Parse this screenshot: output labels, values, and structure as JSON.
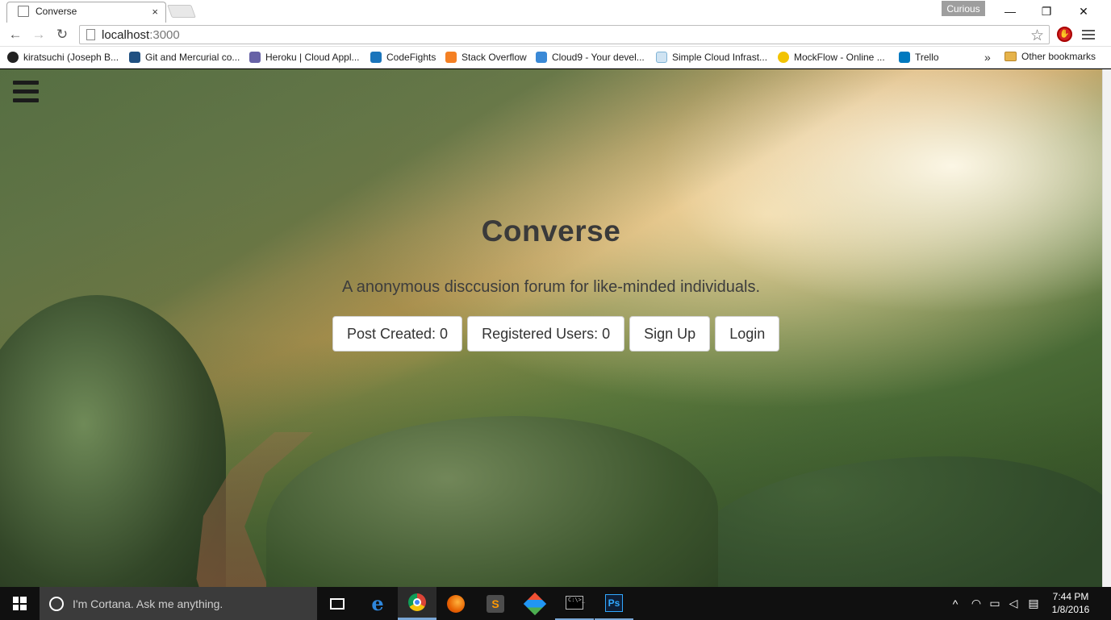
{
  "window": {
    "tab_title": "Converse",
    "tab_close": "×",
    "profile_badge": "Curious",
    "minimize": "—",
    "restore": "❐",
    "close": "✕"
  },
  "toolbar": {
    "back": "←",
    "forward": "→",
    "reload": "↻",
    "url_host": "localhost",
    "url_port": ":3000",
    "star": "☆"
  },
  "bookmarks": {
    "items": [
      {
        "label": "kiratsuchi (Joseph B...",
        "icon": "github-icon",
        "color": "#222222"
      },
      {
        "label": "Git and Mercurial co...",
        "icon": "bitbucket-icon",
        "color": "#205081"
      },
      {
        "label": "Heroku | Cloud Appl...",
        "icon": "heroku-icon",
        "color": "#6762a6"
      },
      {
        "label": "CodeFights",
        "icon": "codefights-icon",
        "color": "#1b75bb"
      },
      {
        "label": "Stack Overflow",
        "icon": "stackoverflow-icon",
        "color": "#f48024"
      },
      {
        "label": "Cloud9 - Your devel...",
        "icon": "cloud9-icon",
        "color": "#3a89d6"
      },
      {
        "label": "Simple Cloud Infrast...",
        "icon": "cloud-icon",
        "color": "#7fb3d5"
      },
      {
        "label": "MockFlow - Online ...",
        "icon": "mockflow-icon",
        "color": "#f2c300"
      },
      {
        "label": "Trello",
        "icon": "trello-icon",
        "color": "#0079bf"
      }
    ],
    "overflow": "»",
    "other": "Other bookmarks"
  },
  "page": {
    "title": "Converse",
    "subtitle": "A anonymous disccusion forum for like-minded individuals.",
    "buttons": {
      "posts": "Post Created: 0",
      "users": "Registered Users: 0",
      "signup": "Sign Up",
      "login": "Login"
    }
  },
  "taskbar": {
    "cortana_placeholder": "I'm Cortana. Ask me anything.",
    "sublime_letter": "S",
    "ps_label": "Ps",
    "cmd_label": "C:\\>_",
    "tray_chevron": "^",
    "time": "7:44 PM",
    "date": "1/8/2016"
  }
}
